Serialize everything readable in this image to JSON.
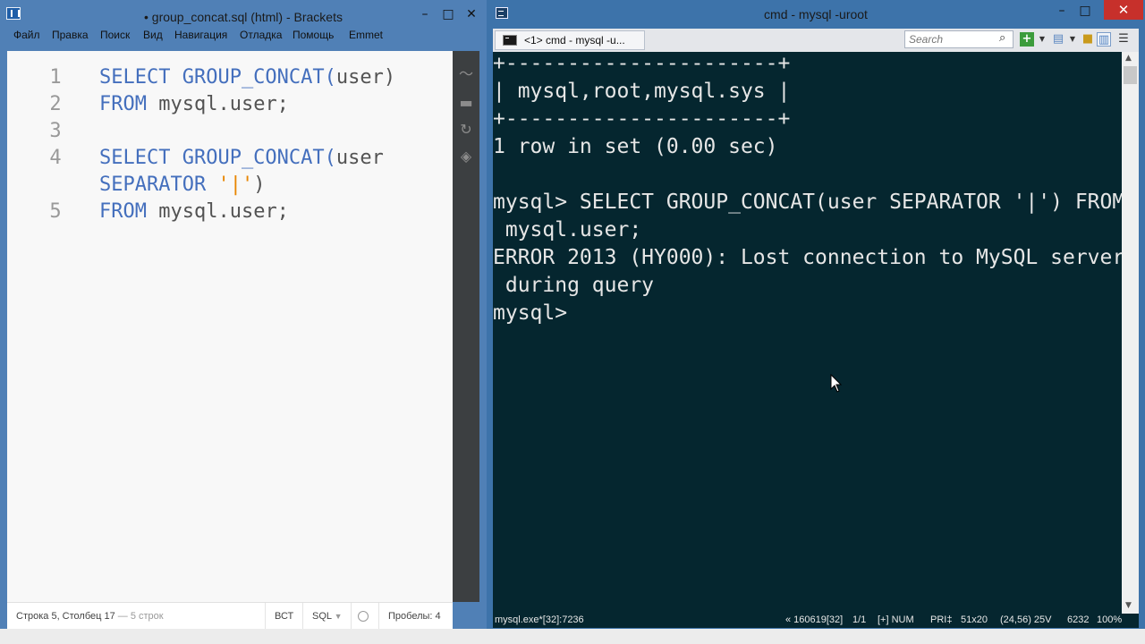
{
  "brackets": {
    "title": "• group_concat.sql (html) - Brackets",
    "menu": [
      "Файл",
      "Правка",
      "Поиск",
      "Вид",
      "Навигация",
      "Отладка",
      "Помощь",
      "Emmet"
    ],
    "lines": [
      {
        "num": "1",
        "tokens": [
          {
            "t": "SELECT GROUP_CONCAT(",
            "c": "kw"
          },
          {
            "t": "user)",
            "c": "tx"
          }
        ]
      },
      {
        "num": "2",
        "tokens": [
          {
            "t": "FROM ",
            "c": "kw"
          },
          {
            "t": "mysql.user;",
            "c": "tx"
          }
        ]
      },
      {
        "num": "3",
        "tokens": []
      },
      {
        "num": "4",
        "tokens": [
          {
            "t": "SELECT GROUP_CONCAT(",
            "c": "kw"
          },
          {
            "t": "user",
            "c": "tx"
          }
        ]
      },
      {
        "num": "",
        "tokens": [
          {
            "t": "SEPARATOR ",
            "c": "kw"
          },
          {
            "t": "'|'",
            "c": "str"
          },
          {
            "t": ")",
            "c": "tx"
          }
        ]
      },
      {
        "num": "5",
        "tokens": [
          {
            "t": "FROM ",
            "c": "kw"
          },
          {
            "t": "mysql.user;",
            "c": "tx"
          }
        ]
      }
    ],
    "status": {
      "position": "Строка 5, Столбец 17",
      "line_count": "— 5 строк",
      "insert_mode": "ВСТ",
      "language": "SQL",
      "indent": "Пробелы: 4"
    }
  },
  "cmd": {
    "title": "cmd - mysql  -uroot",
    "tab_label": "<1> cmd - mysql  -u...",
    "search_placeholder": "Search",
    "console_lines": [
      "+----------------------+",
      "| mysql,root,mysql.sys |",
      "+----------------------+",
      "1 row in set (0.00 sec)",
      "",
      "mysql> SELECT GROUP_CONCAT(user SEPARATOR '|') FROM",
      " mysql.user;",
      "ERROR 2013 (HY000): Lost connection to MySQL server",
      " during query",
      "mysql> "
    ],
    "status": {
      "process": "mysql.exe*[32]:7236",
      "pos": "« 160619[32]",
      "page": "1/1",
      "mode": "[+] NUM",
      "pri": "PRI‡",
      "size": "51x20",
      "cursor": "(24,56) 25V",
      "code": "6232",
      "zoom": "100%"
    }
  }
}
